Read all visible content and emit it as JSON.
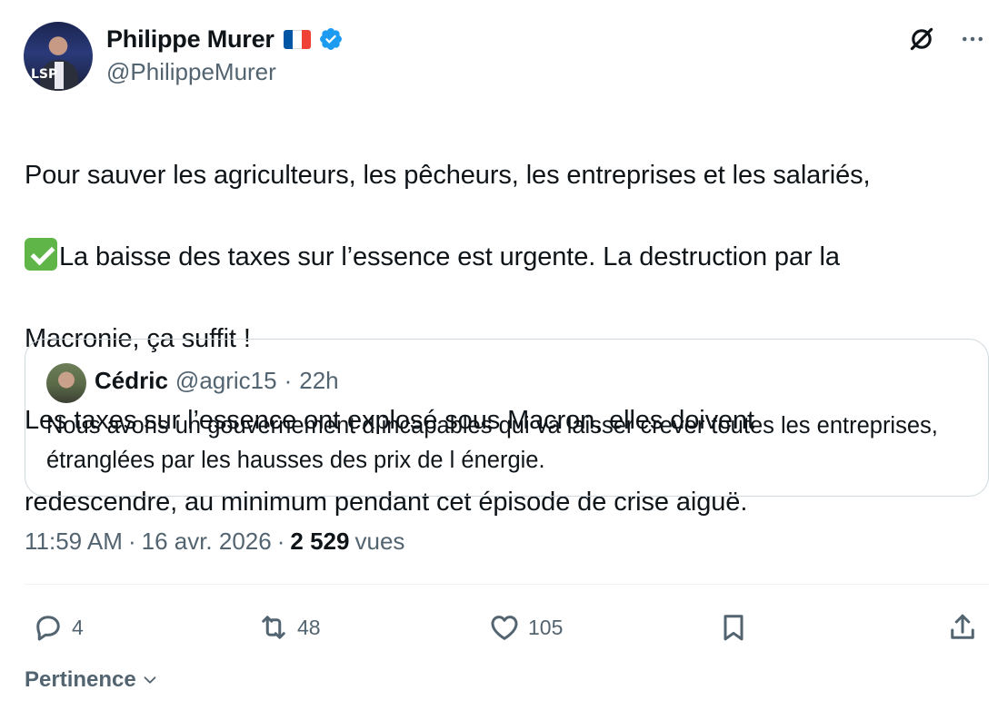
{
  "author": {
    "name": "Philippe Murer",
    "handle": "@PhilippeMurer",
    "avatar_badge": "LSP",
    "flag": [
      "#0055a4",
      "#ffffff",
      "#ef4135"
    ],
    "verified_color": "#1d9bf0"
  },
  "top_actions": {
    "grok_icon": "grok-icon",
    "more_icon": "more-icon"
  },
  "tweet": {
    "line1": "Pour sauver les agriculteurs, les pêcheurs, les entreprises et les salariés,",
    "line2": "La baisse des taxes sur l’essence est urgente. La destruction par la",
    "line3": "Macronie, ça suffit !",
    "line4": "Les taxes sur l’essence ont explosé sous Macron, elles doivent",
    "line5": "redescendre, au minimum pendant cet épisode de crise aiguë."
  },
  "quote": {
    "name": "Cédric",
    "handle": "@agric15",
    "separator": "·",
    "time": "22h",
    "text": "Nous avons un gouvernement d incapables qui va laisser crever toutes les entreprises, étranglées par les hausses des prix de l énergie."
  },
  "meta": {
    "time": "11:59 AM",
    "sep1": "·",
    "date": "16 avr. 2026",
    "sep2": "·",
    "views_count": "2 529",
    "views_label": "vues"
  },
  "actions": {
    "replies": "4",
    "reposts": "48",
    "likes": "105"
  },
  "sort": {
    "label": "Pertinence"
  },
  "colors": {
    "text": "#0f1419",
    "secondary": "#536471",
    "border": "#cfd9de",
    "check": "#5fb548"
  }
}
